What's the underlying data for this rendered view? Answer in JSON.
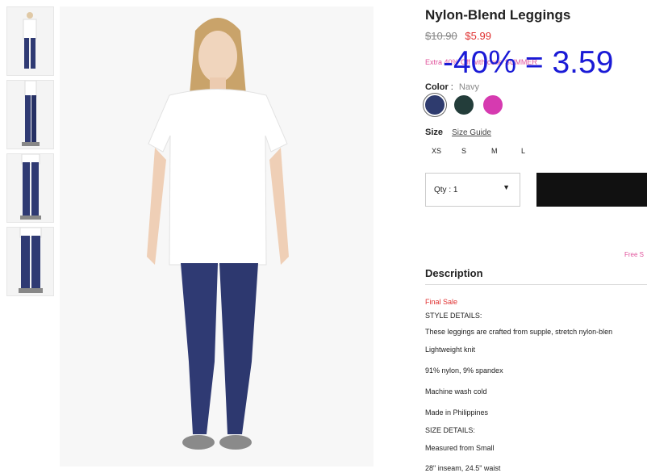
{
  "product": {
    "title": "Nylon-Blend Leggings",
    "old_price": "$10.90",
    "new_price": "$5.99",
    "promo_text": "Extra 40% Off with code SUMMER",
    "overlay_text": "-40% = 3.59",
    "color_label": "Color",
    "color_value": "Navy",
    "swatches": [
      {
        "name": "navy",
        "color": "#2e3b6e"
      },
      {
        "name": "dark-green",
        "color": "#233d3a"
      },
      {
        "name": "pink",
        "color": "#d63ab0"
      }
    ],
    "size_label": "Size",
    "size_guide": "Size Guide",
    "sizes": [
      "XS",
      "S",
      "M",
      "L"
    ],
    "qty_label": "Qty : 1",
    "free_shipping": "Free S"
  },
  "description": {
    "title": "Description",
    "final_sale": "Final Sale",
    "lines": [
      "STYLE DETAILS:",
      "These leggings are crafted from supple, stretch nylon-blen",
      "Lightweight knit",
      "91% nylon, 9% spandex",
      "Machine wash cold",
      "Made in Philippines",
      "SIZE DETAILS:",
      "Measured from Small",
      "28\" inseam, 24.5\" waist"
    ]
  },
  "images": {
    "thumbnails": [
      "thumbnail-1",
      "thumbnail-2",
      "thumbnail-3",
      "thumbnail-4"
    ]
  }
}
